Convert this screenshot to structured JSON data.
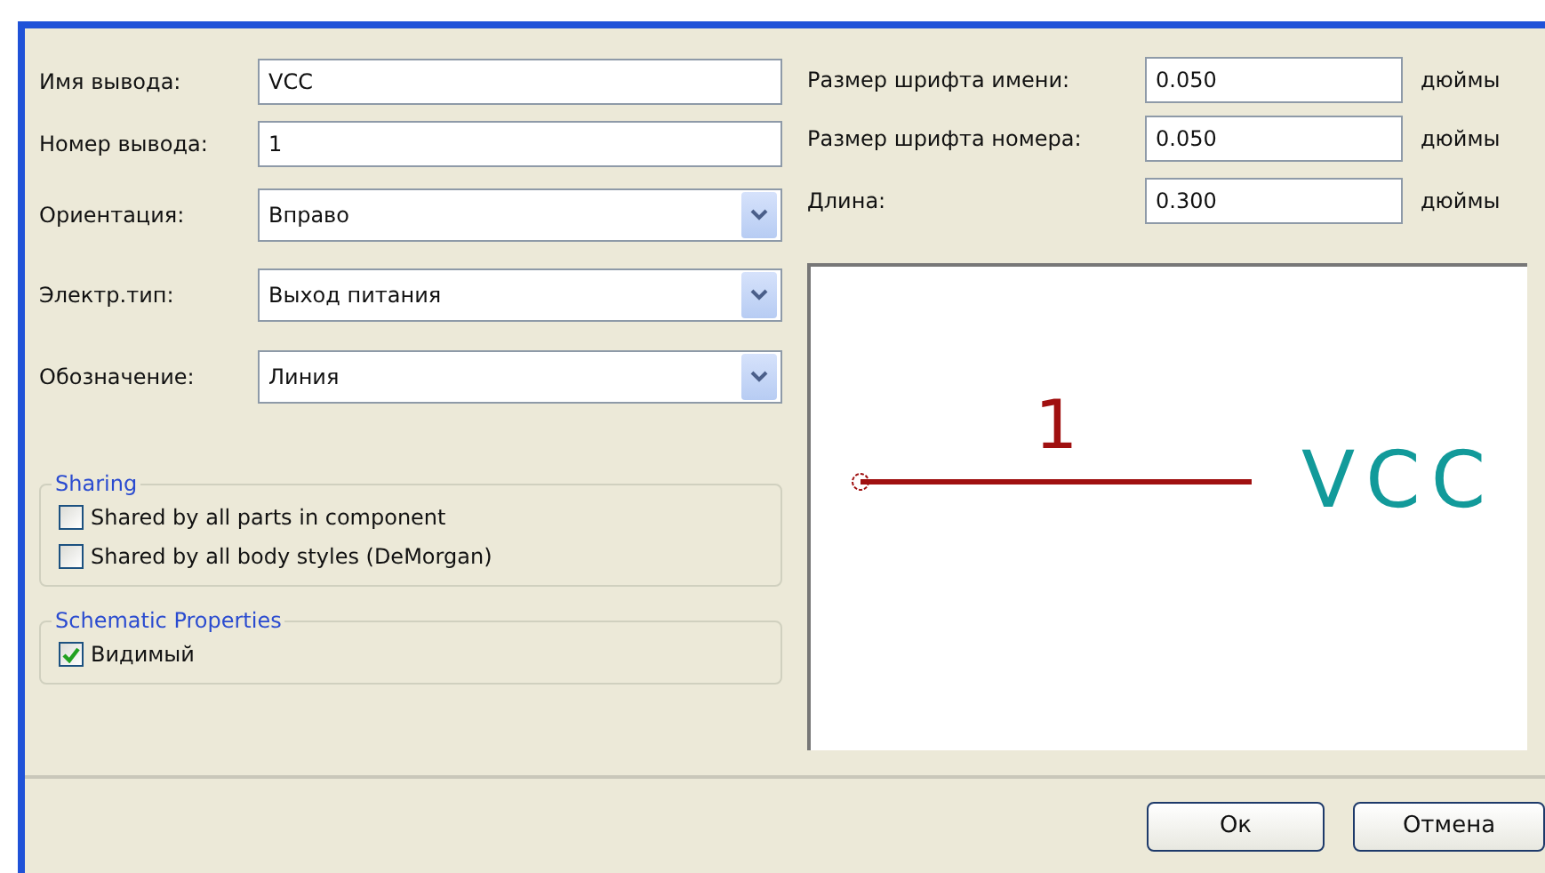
{
  "left_fields": [
    {
      "kind": "text",
      "label": "Имя вывода:",
      "value": "VCC"
    },
    {
      "kind": "text",
      "label": "Номер вывода:",
      "value": "1"
    },
    {
      "kind": "select",
      "label": "Ориентация:",
      "value": "Вправо"
    },
    {
      "kind": "select",
      "label": "Электр.тип:",
      "value": "Выход питания"
    },
    {
      "kind": "select",
      "label": "Обозначение:",
      "value": "Линия"
    }
  ],
  "right_fields": [
    {
      "label": "Размер шрифта имени:",
      "value": "0.050",
      "unit": "дюймы"
    },
    {
      "label": "Размер шрифта номера:",
      "value": "0.050",
      "unit": "дюймы"
    },
    {
      "label": "Длина:",
      "value": "0.300",
      "unit": "дюймы"
    }
  ],
  "groups": [
    {
      "title": "Sharing",
      "options": [
        {
          "label": "Shared by all parts in component",
          "checked": false
        },
        {
          "label": "Shared by all body styles (DeMorgan)",
          "checked": false
        }
      ]
    },
    {
      "title": "Schematic Properties",
      "options": [
        {
          "label": "Видимый",
          "checked": true
        }
      ]
    }
  ],
  "preview": {
    "pin_number": "1",
    "pin_name": "VCC"
  },
  "buttons": [
    "Ок",
    "Отмена"
  ]
}
